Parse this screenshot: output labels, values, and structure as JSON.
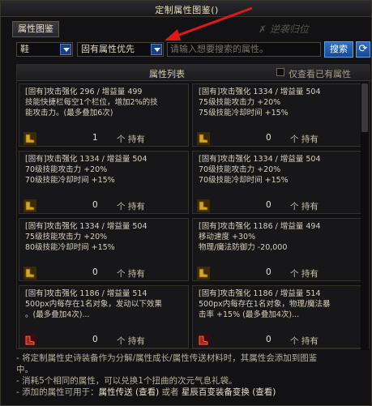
{
  "window": {
    "title": "定制属性图鉴()",
    "watermark": "✗ 逆袭归位"
  },
  "tabs": [
    {
      "label": "属性图鉴"
    }
  ],
  "filters": {
    "slot_select": "鞋",
    "sort_select": "固有属性优先",
    "search_placeholder": "请输入想要搜索的属性。",
    "search_button": "搜索",
    "refresh_icon": "refresh-icon"
  },
  "panel": {
    "title": "属性列表",
    "owned_only_label": "仅查看已有属性"
  },
  "cards": [
    {
      "lines": [
        "[固有]攻击强化 296 / 增益量 499",
        "技能快捷栏每空1个栏位，增加2%的技",
        "能攻击力。(最多叠加6次)"
      ],
      "count": "1",
      "owned_label": "个 持有",
      "icon": "gold-shoe-icon"
    },
    {
      "lines": [
        "[固有]攻击强化 1334 / 增益量 504",
        "75级技能攻击力 +20%",
        "75级技能冷却时间 +15%"
      ],
      "count": "0",
      "owned_label": "个 持有",
      "icon": "gold-shoe-icon"
    },
    {
      "lines": [
        "[固有]攻击强化 1334 / 增益量 504",
        "70级技能攻击力 +20%",
        "70级技能冷却时间 +15%"
      ],
      "count": "0",
      "owned_label": "个 持有",
      "icon": "gold-shoe-icon"
    },
    {
      "lines": [
        "[固有]攻击强化 1334 / 增益量 504",
        "70级技能攻击力 +20%",
        "70级技能冷却时间 +15%"
      ],
      "count": "0",
      "owned_label": "个 持有",
      "icon": "gold-shoe-icon"
    },
    {
      "lines": [
        "[固有]攻击强化 1334 / 增益量 504",
        "75级技能攻击力 +20%",
        "80级技能冷却时间 +15%"
      ],
      "count": "0",
      "owned_label": "个 持有",
      "icon": "gold-shoe-icon"
    },
    {
      "lines": [
        "[固有]攻击强化 1186 / 增益量 494",
        "移动速度 +30%",
        "物理/魔法防御力 -20,000"
      ],
      "count": "0",
      "owned_label": "个 持有",
      "icon": "gold-shoe-icon"
    },
    {
      "lines": [
        "[固有]攻击强化 1186 / 增益量 514",
        "500px内每存在1名对象，发动以下效果",
        "。(最多叠加4次)..."
      ],
      "count": "0",
      "owned_label": "个 持有",
      "icon": "red-shoe-icon"
    },
    {
      "lines": [
        "[固有]攻击强化 1186 / 增益量 514",
        "500px内每存在1名对象，物理/魔法暴",
        "击率 +15% (最多叠加4次)..."
      ],
      "count": "0",
      "owned_label": "个 持有",
      "icon": "red-shoe-icon"
    }
  ],
  "notes": {
    "line1": "- 将定制属性史诗装备作为分解/属性成长/属性传送材料时，其属性会添加到图鉴",
    "line1b": "中。",
    "line2": "- 消耗5个相同的属性，可以兑换1个扭曲的次元气息礼袋。",
    "line3_prefix": "- 添加的属性可用于：",
    "line3_link1": "属性传送 (查看)",
    "line3_mid": " 或者 ",
    "line3_link2": "星辰百变装备变换 (查看)"
  },
  "colors": {
    "accent_blue": "#2b6fc4",
    "arrow_red": "#e01818",
    "gold_icon": "#d9a520",
    "red_icon": "#b3182a"
  }
}
